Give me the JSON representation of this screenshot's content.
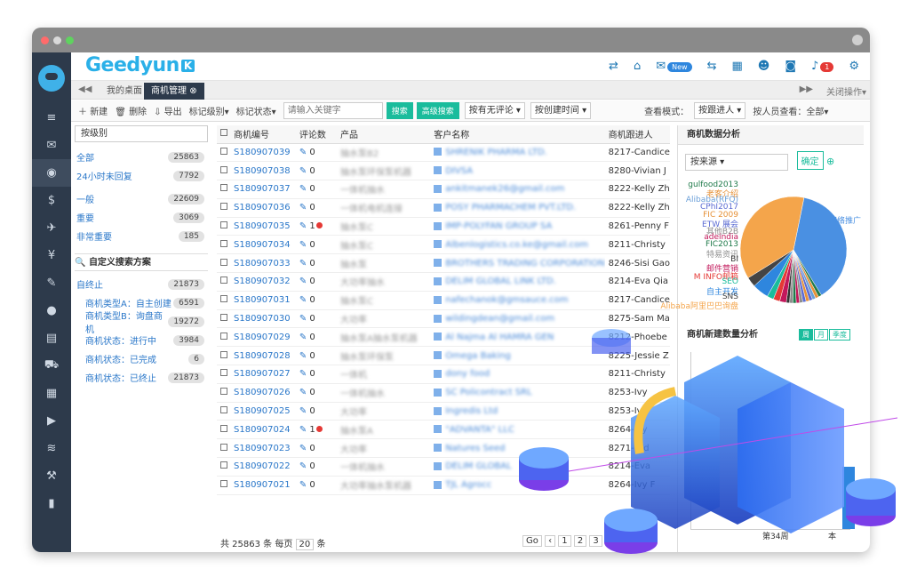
{
  "brand": {
    "name": "Geedyun",
    "badge": "K"
  },
  "header": {
    "new_badge": "New",
    "notif_count": "1"
  },
  "tabs": {
    "home": "我的桌面",
    "active": "商机管理",
    "close_ops": "关闭操作"
  },
  "toolbar": {
    "new": "新建",
    "delete": "删除",
    "export": "导出",
    "mark_level": "标记级别",
    "mark_status": "标记状态",
    "search_placeholder": "请输入关键字",
    "search": "搜索",
    "advanced": "高级搜索",
    "comment_sort": "按有无评论",
    "created_sort": "按创建时间",
    "view_mode_label": "查看模式：",
    "view_mode": "按跟进人",
    "staff_view": "按人员查看：全部"
  },
  "left_panel": {
    "level_select": "按级别",
    "groups": [
      {
        "label": "全部",
        "count": "25863"
      },
      {
        "label": "24小时未回复",
        "count": "7792"
      },
      {
        "label": "一般",
        "count": "22609"
      },
      {
        "label": "重要",
        "count": "3069"
      },
      {
        "label": "非常重要",
        "count": "185"
      }
    ],
    "custom_title": "自定义搜索方案",
    "custom": [
      {
        "label": "自终止",
        "count": "21873"
      },
      {
        "label": "商机类型A：自主创建",
        "count": "6591"
      },
      {
        "label": "商机类型B：询盘商机",
        "count": "19272"
      },
      {
        "label": "商机状态：进行中",
        "count": "3984"
      },
      {
        "label": "商机状态：已完成",
        "count": "6"
      },
      {
        "label": "商机状态：已终止",
        "count": "21873"
      }
    ]
  },
  "table": {
    "headers": [
      "商机编号",
      "评论数",
      "产品",
      "客户名称",
      "商机跟进人"
    ],
    "rows": [
      {
        "code": "S180907039",
        "comments": "0",
        "product": "抽水泵B2",
        "customer": "SHRENIK PHARMA LTD.",
        "owner": "8217-Candice"
      },
      {
        "code": "S180907038",
        "comments": "0",
        "product": "抽水泵环保泵机器",
        "customer": "DIVSA",
        "owner": "8280-Vivian J"
      },
      {
        "code": "S180907037",
        "comments": "0",
        "product": "一体机抽水",
        "customer": "ankitmanek26@gmail.com",
        "owner": "8222-Kelly Zh"
      },
      {
        "code": "S180907036",
        "comments": "0",
        "product": "一体机电机连接",
        "customer": "POSY PHARMACHEM PVT.LTD.",
        "owner": "8222-Kelly Zh"
      },
      {
        "code": "S180907035",
        "comments": "1",
        "product": "抽水泵C",
        "customer": "IMP-POLYFAN GROUP SA",
        "owner": "8261-Penny F"
      },
      {
        "code": "S180907034",
        "comments": "0",
        "product": "抽水泵C",
        "customer": "Albenlogistics.co.ke@gmail.com",
        "owner": "8211-Christy"
      },
      {
        "code": "S180907033",
        "comments": "0",
        "product": "抽水泵",
        "customer": "BROTHERS TRADING CORPORATION",
        "owner": "8246-Sisi Gao"
      },
      {
        "code": "S180907032",
        "comments": "0",
        "product": "大功率抽水",
        "customer": "DELIM GLOBAL LINK LTD.",
        "owner": "8214-Eva Qia"
      },
      {
        "code": "S180907031",
        "comments": "0",
        "product": "抽水泵C",
        "customer": "nafechanok@gmsauce.com",
        "owner": "8217-Candice"
      },
      {
        "code": "S180907030",
        "comments": "0",
        "product": "大功率",
        "customer": "wildingdean@gmail.com",
        "owner": "8275-Sam Ma"
      },
      {
        "code": "S180907029",
        "comments": "0",
        "product": "抽水泵A抽水泵机器",
        "customer": "Al Najma Al HAMRA GEN",
        "owner": "8212-Phoebe"
      },
      {
        "code": "S180907028",
        "comments": "0",
        "product": "抽水泵环保泵",
        "customer": "Omega Baking",
        "owner": "8225-Jessie Z"
      },
      {
        "code": "S180907027",
        "comments": "0",
        "product": "一体机",
        "customer": "dony food",
        "owner": "8211-Christy"
      },
      {
        "code": "S180907026",
        "comments": "0",
        "product": "一体机抽水",
        "customer": "SC Policontract SRL",
        "owner": "8253-Ivy"
      },
      {
        "code": "S180907025",
        "comments": "0",
        "product": "大功率",
        "customer": "Ingredis Ltd",
        "owner": "8253-Ivy"
      },
      {
        "code": "S180907024",
        "comments": "1",
        "product": "抽水泵A",
        "customer": "\"ADVANTA\" LLC",
        "owner": "8264-Ivy"
      },
      {
        "code": "S180907023",
        "comments": "0",
        "product": "大功率",
        "customer": "Natures Seed",
        "owner": "8271-Lyd"
      },
      {
        "code": "S180907022",
        "comments": "0",
        "product": "一体机抽水",
        "customer": "DELIM GLOBAL",
        "owner": "8214-Eva"
      },
      {
        "code": "S180907021",
        "comments": "0",
        "product": "大功率抽水泵机器",
        "customer": "TJL Agrocc",
        "owner": "8264-Ivy F"
      }
    ]
  },
  "pager": {
    "summary": "共 25863 条 每页",
    "per_page": "20",
    "unit": "条",
    "go": "Go",
    "pages": [
      "1",
      "2",
      "3"
    ]
  },
  "analysis": {
    "title": "商机数据分析",
    "source_select": "按来源",
    "confirm": "确定",
    "trend_title": "商机新建数量分析",
    "periods": [
      "周",
      "月",
      "季度"
    ],
    "week_label": "第34周",
    "more_label": "本"
  },
  "chart_data": {
    "type": "pie",
    "categories": [
      "网络推广",
      "gulfood2013",
      "老客介绍",
      "Alibaba(RFQ)",
      "CPhI2017",
      "FIC 2009",
      "ETW 展会",
      "其他B2B",
      "adeindia",
      "FIC2013",
      "特易资讯",
      "BI",
      "邮件营销",
      "M INFO邮箱",
      "SEO",
      "自主开发",
      "SNS",
      "Alibaba阿里巴巴询盘"
    ],
    "values": [
      38,
      1,
      1,
      1,
      1,
      1,
      1,
      1,
      1,
      1,
      1,
      1,
      2,
      2,
      2,
      5,
      3,
      37
    ],
    "colors": [
      "#4a90e2",
      "#1f7a4a",
      "#e69138",
      "#6a9fd8",
      "#5b6bd3",
      "#e69138",
      "#5b6bd3",
      "#8e8e8e",
      "#c2185b",
      "#1f7a4a",
      "#8e8e8e",
      "#333333",
      "#c2185b",
      "#e53935",
      "#1abc9c",
      "#2e86de",
      "#444444",
      "#f4a54b"
    ]
  }
}
